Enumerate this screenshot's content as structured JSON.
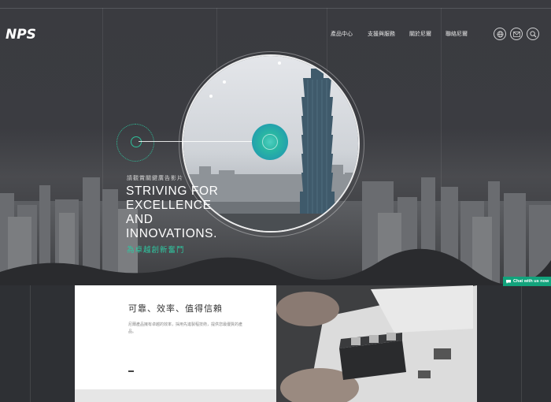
{
  "brand": {
    "logo_text": "NPS"
  },
  "nav": {
    "items": [
      "產品中心",
      "支援與服務",
      "關於尼爾",
      "聯絡尼爾"
    ],
    "icons": [
      "globe-icon",
      "mail-icon",
      "search-icon"
    ]
  },
  "hero": {
    "small_text": "請觀賞關鍵廣告影片",
    "title_lines": [
      "STRIVING FOR",
      "EXCELLENCE",
      "AND",
      "INNOVATIONS."
    ],
    "subtitle": "為卓越創新奮鬥",
    "accent_color": "#2fc7a1"
  },
  "chat": {
    "label": "Chat with us now"
  },
  "section": {
    "title": "可靠、效率、值得信賴",
    "text": "尼爾產品擁有卓越的效率，採用先進製程技術，提供您最優質的產品。"
  }
}
